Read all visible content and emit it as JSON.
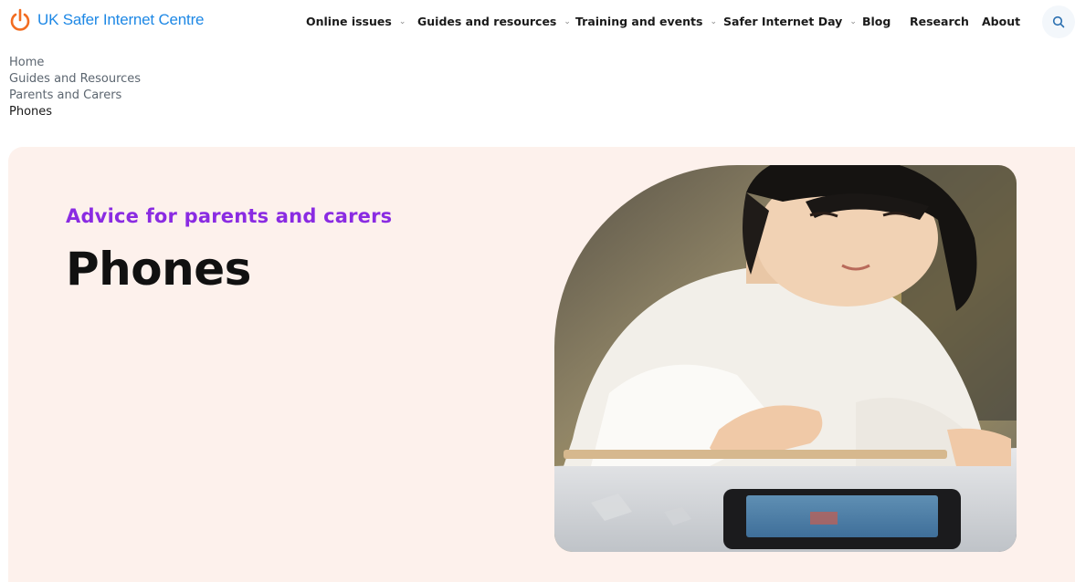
{
  "header": {
    "logo_text": "UK Safer Internet Centre",
    "brand_color": "#1e88e5",
    "logo_accent": "#f26d21"
  },
  "nav": {
    "items": [
      {
        "label": "Online issues",
        "has_dropdown": true
      },
      {
        "label": "Guides and resources",
        "has_dropdown": true
      },
      {
        "label": "Training and events",
        "has_dropdown": true
      },
      {
        "label": "Safer Internet Day",
        "has_dropdown": true
      },
      {
        "label": "Blog",
        "has_dropdown": false
      },
      {
        "label": "Research",
        "has_dropdown": false
      },
      {
        "label": "About",
        "has_dropdown": false
      }
    ],
    "search_icon": "search-icon"
  },
  "breadcrumb": {
    "items": [
      "Home",
      "Guides and Resources",
      "Parents and Carers",
      "Phones"
    ]
  },
  "hero": {
    "kicker": "Advice for parents and carers",
    "title": "Phones",
    "background_color": "#fdf1ec",
    "kicker_color": "#8a2be2"
  }
}
